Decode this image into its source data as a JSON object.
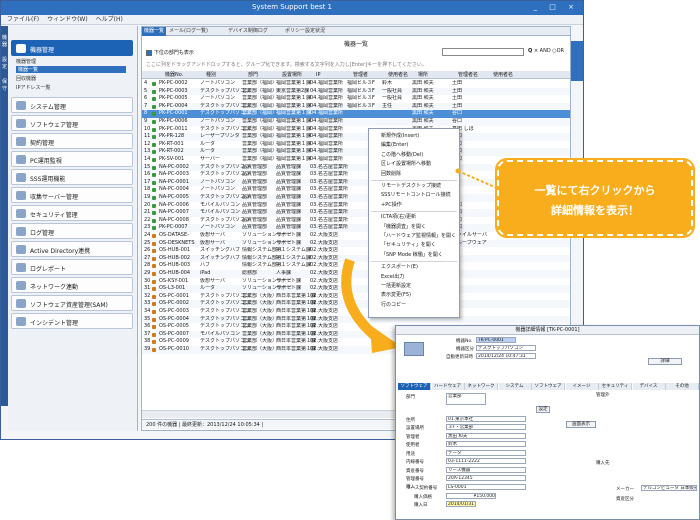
{
  "window": {
    "title": "System Support best 1",
    "controls": "_ □ ×"
  },
  "menu": [
    "ファイル(F)",
    "ウィンドウ(W)",
    "ヘルプ(H)"
  ],
  "left_strip": [
    "機器",
    "設定",
    "保守"
  ],
  "sidebar": {
    "items": [
      {
        "label": "機器管理",
        "selected": true
      },
      {
        "label": "システム管理"
      },
      {
        "label": "ソフトウェア管理"
      },
      {
        "label": "契約管理"
      },
      {
        "label": "PC運用監視"
      },
      {
        "label": "SSS運用機能"
      },
      {
        "label": "収集サーバー管理"
      },
      {
        "label": "セキュリティ管理"
      },
      {
        "label": "ログ管理"
      },
      {
        "label": "Active Directory連携"
      },
      {
        "label": "ログレポート"
      },
      {
        "label": "ネットワーク連動"
      },
      {
        "label": "ソフトウェア資産管理(SAM)"
      },
      {
        "label": "インシデント管理"
      }
    ],
    "sub_head": "機器管理",
    "sub_items": [
      "機器一覧",
      "回収機器",
      "IPアドレス一覧"
    ]
  },
  "main": {
    "tabs": [
      "機器一覧",
      "メール(ログ一覧)",
      "デバイス制御ログ",
      "ポリシー設定状況"
    ],
    "page_title": "機器一覧",
    "filter_check": "下位の部門も表示",
    "search_placeholder": "",
    "search_opts": "AND ○OR",
    "hint": "ここに列をドラッグアンドドロップすると、グループ化できます。検索する文字列を入力し[Enter]キーを押下してください。",
    "columns": [
      "",
      "機器No.",
      "種別",
      "部門",
      "設置場所",
      "IP",
      "管理者",
      "使用者名",
      "場所",
      "管理者名",
      "使用者名"
    ],
    "rows": [
      [
        "4",
        "PK-PC-0002",
        "ノートパソコン",
        "営業部（福岡）",
        "福岡営業第１課",
        "04.福岡営業所",
        "福岡ビル３F",
        "鈴木",
        "黒田 和夫",
        "土田",
        "#3a9a3a"
      ],
      [
        "5",
        "PK-PC-0003",
        "デスクトップパソコン",
        "営業部（福岡）",
        "東京営業第2課",
        "04.福岡営業所",
        "福岡ビル３F",
        "一般社員",
        "黒田 和夫",
        "土田",
        "#3a9a3a"
      ],
      [
        "6",
        "PK-PC-0005",
        "ノートパソコン",
        "営業部（福岡）",
        "福岡営業第１課",
        "04.福岡営業所",
        "福岡ビル３F",
        "一般社員",
        "黒田 和夫",
        "土田",
        "#3a9a3a"
      ],
      [
        "7",
        "PK-PC-0004",
        "デスクトップパソコン",
        "営業部（福岡）",
        "福岡営業第１課",
        "04.福岡営業所",
        "福岡ビル３F",
        "主任",
        "黒田 和夫",
        "土田",
        "#3a9a3a"
      ],
      [
        "8",
        "PK-PC-0001",
        "デスクトップパソコン",
        "営業部（福岡）",
        "福岡営業第１課",
        "04.福岡営業所",
        "",
        "",
        "黒田 和夫",
        "谷口",
        "#3a9a3a"
      ],
      [
        "9",
        "PK-PC-0006",
        "ノートパソコン",
        "営業部（福岡）",
        "福岡営業第１課",
        "04.福岡営業所",
        "",
        "",
        "黒田 和夫",
        "谷口",
        "#3a9a3a"
      ],
      [
        "10",
        "PK-PC-0011",
        "デスクトップパソコン",
        "営業部（福岡）",
        "福岡営業第１課",
        "04.福岡営業所",
        "",
        "",
        "黒田 和夫",
        "真田 しほ",
        "#3a9a3a"
      ],
      [
        "11",
        "PK-PR-128",
        "レーザープリンタ",
        "営業部（福岡）",
        "福岡営業第１課",
        "04.福岡営業所",
        "",
        "",
        "黒田 和夫",
        "谷口",
        "#3a9a3a"
      ],
      [
        "12",
        "PK-RT-001",
        "ルータ",
        "営業部（福岡）",
        "福岡営業第１課",
        "04.福岡営業所",
        "",
        "",
        "黒田 和夫",
        "谷口",
        "#3a9a3a"
      ],
      [
        "13",
        "PK-RT-002",
        "ルータ",
        "営業部（福岡）",
        "福岡営業第１課",
        "04.福岡営業所",
        "",
        "",
        "黒田 和夫",
        "谷口",
        "#3a9a3a"
      ],
      [
        "14",
        "PK-SV-001",
        "サーバー",
        "営業部（福岡）",
        "福岡営業第１課",
        "04.福岡営業所",
        "",
        "",
        "黒田 和夫",
        "谷口",
        "#3a9a3a"
      ],
      [
        "15",
        "NA-PC-0002",
        "デスクトップパソコン",
        "品質管理部",
        "品質管理課",
        "03.名古屋営業所",
        "",
        "",
        "太田 和夫",
        "",
        "#3a9a3a"
      ],
      [
        "16",
        "NA-PC-0003",
        "デスクトップパソコン",
        "品質管理部",
        "品質管理課",
        "03.名古屋営業所",
        "",
        "",
        "太田 和夫",
        "",
        "#3a9a3a"
      ],
      [
        "17",
        "NA-PC-0001",
        "ノートパソコン",
        "品質管理部",
        "品質管理課",
        "03.名古屋営業所",
        "",
        "",
        "太田 和夫",
        "",
        "#3a9a3a"
      ],
      [
        "18",
        "NA-PC-0004",
        "ノートパソコン",
        "品質管理部",
        "品質管理課",
        "03.名古屋営業所",
        "",
        "",
        "太田 和夫",
        "",
        "#3a9a3a"
      ],
      [
        "19",
        "NA-PC-0005",
        "デスクトップパソコン",
        "品質管理部",
        "品質管理課",
        "03.名古屋営業所",
        "",
        "",
        "太田 和夫",
        "",
        "#3a9a3a"
      ],
      [
        "20",
        "NA-PC-0006",
        "モバイルパソコン",
        "品質管理部",
        "品質管理課",
        "03.名古屋営業所",
        "",
        "",
        "太田 和夫",
        "谷口",
        "#3a9a3a"
      ],
      [
        "21",
        "NA-PC-0007",
        "モバイルパソコン",
        "品質管理部",
        "品質管理課",
        "03.名古屋営業所",
        "",
        "",
        "太田 和夫",
        "谷口",
        "#3a9a3a"
      ],
      [
        "22",
        "NA-PC-0008",
        "デスクトップパソコン",
        "品質管理部",
        "品質管理課",
        "03.名古屋営業所",
        "",
        "",
        "太田 和夫",
        "谷口",
        "#3a9a3a"
      ],
      [
        "23",
        "PK-PC-0007",
        "ノートパソコン",
        "品質管理部",
        "品質管理課",
        "03.名古屋営業所",
        "",
        "",
        "太田 和夫",
        "谷口",
        "#3a9a3a"
      ],
      [
        "24",
        "OS-DATASE-",
        "仮想サーバ",
        "ソリューションサービ",
        "サポート課",
        "02.大阪支店",
        "",
        "",
        "木下 紫",
        "ファイルサーバ",
        "#d07a1a"
      ],
      [
        "25",
        "OS-DESKNETS",
        "仮想サーバ",
        "ソリューションサービ",
        "サポート課",
        "02.大阪支店",
        "",
        "",
        "木下 紫",
        "グループウェア",
        "#d07a1a"
      ],
      [
        "26",
        "OS-HUB-001",
        "スイッチングハブ",
        "情報システム部（",
        "第１システム課",
        "02.大阪支店",
        "",
        "",
        "木下 紫",
        "",
        "#d07a1a"
      ],
      [
        "27",
        "OS-HUB-002",
        "スイッチングハブ",
        "情報システム部（",
        "第１システム課",
        "02.大阪支店",
        "",
        "",
        "",
        "",
        "#d07a1a"
      ],
      [
        "28",
        "OS-HUB-003",
        "ハブ",
        "情報システム部（",
        "第１システム課",
        "02.大阪支店",
        "",
        "",
        "",
        "",
        "#d07a1a"
      ],
      [
        "29",
        "OS-HUB-004",
        "iPad",
        "総務部",
        "人事課",
        "02.大阪支店",
        "",
        "",
        "",
        "",
        "#d07a1a"
      ],
      [
        "30",
        "OS-KSY-001",
        "仮想サーバ",
        "ソリューションサービ",
        "サポート課",
        "02.大阪支店",
        "",
        "",
        "",
        "",
        "#d07a1a"
      ],
      [
        "31",
        "OS-L3-001",
        "ルータ",
        "ソリューションサービ",
        "サポート課",
        "02.大阪支店",
        "",
        "",
        "",
        "",
        "#d07a1a"
      ],
      [
        "32",
        "OS-PC-0001",
        "デスクトップパソコン",
        "営業部（大阪）",
        "西日本営業第１課",
        "02.大阪支店",
        "",
        "",
        "",
        "",
        "#d07a1a"
      ],
      [
        "33",
        "OS-PC-0002",
        "デスクトップパソコン",
        "営業部（大阪）",
        "西日本営業第１課",
        "02.大阪支店",
        "",
        "",
        "",
        "",
        "#d07a1a"
      ],
      [
        "34",
        "OS-PC-0003",
        "デスクトップパソコン",
        "営業部（大阪）",
        "西日本営業第１課",
        "02.大阪支店",
        "",
        "",
        "",
        "",
        "#d07a1a"
      ],
      [
        "35",
        "OS-PC-0004",
        "デスクトップパソコン",
        "営業部（大阪）",
        "西日本営業第１課",
        "02.大阪支店",
        "",
        "",
        "",
        "",
        "#d07a1a"
      ],
      [
        "36",
        "OS-PC-0005",
        "デスクトップパソコン",
        "営業部（大阪）",
        "西日本営業第１課",
        "02.大阪支店",
        "",
        "",
        "",
        "",
        "#d07a1a"
      ],
      [
        "37",
        "OS-PC-0007",
        "モバイルパソコン",
        "営業部（大阪）",
        "西日本営業第１課",
        "02.大阪支店",
        "",
        "",
        "",
        "",
        "#d07a1a"
      ],
      [
        "38",
        "OS-PC-0009",
        "デスクトップパソコン",
        "営業部（大阪）",
        "西日本営業第１課",
        "02.大阪支店",
        "",
        "",
        "",
        "",
        "#d07a1a"
      ],
      [
        "39",
        "OS-PC-0010",
        "デスクトップパソコン",
        "営業部（大阪）",
        "西日本営業第１課",
        "02.大阪支店",
        "",
        "",
        "",
        "",
        "#d07a1a"
      ]
    ],
    "selected_row": 4,
    "status": "200 件の機器 | 最終更新：2013/12/24 10:05:34 |"
  },
  "context_menu": [
    "新規作成(Insert)",
    "編集(Enter)",
    "この階へ移動(Del)",
    "区レイ設置場所へ移動",
    "回数削除",
    "リモートデスクトップ接続",
    "SSSリモートコントロール接続",
    "+PC操作",
    "ICTA項(右)更新",
    "「機器調査」を開く",
    "「ハードウェア監視情報」を開く",
    "「セキュリティ」を開く",
    "「SNP Mode 稼働」を開く",
    "エクスポート(E)",
    "Excel出力",
    "一括更新設定",
    "表示変更(F5)",
    "行のコピー"
  ],
  "callout": {
    "line1": "一覧にて右クリックから",
    "line2": "詳細情報を表示！"
  },
  "detail": {
    "title": "機器詳細情報 [TK-PC-0001]",
    "device_no_label": "機器No.",
    "device_no": "TK-PC-0001",
    "type_label": "機器区分",
    "type": "デスクトップパソコン",
    "date_label": "自動更新日時",
    "date": "2014/12/24 10:47:31",
    "tabs": [
      "ソフトウェア",
      "ハードウェア",
      "ネットワーク",
      "システム",
      "ソフトウェア",
      "イメージ",
      "セキュリティ",
      "デバイス",
      "その他"
    ],
    "fields": [
      [
        "部門",
        "営業部"
      ],
      [
        "住所",
        "01.東京本社"
      ],
      [
        "設置場所",
        "３F・営業部"
      ],
      [
        "管理者",
        "黒田 和夫"
      ],
      [
        "使用者",
        "鈴木"
      ],
      [
        "用途",
        "データ"
      ],
      [
        "内線番号",
        "03-1111-2222"
      ],
      [
        "資産番号",
        "リース機器"
      ],
      [
        "管理番号",
        "20A-12345"
      ],
      [
        "リース契約番号",
        "LS-0001"
      ]
    ],
    "purchase_label": "購入",
    "price_label": "購入価格",
    "price": "¥150,000",
    "date2_label": "購入日",
    "date2": "2014/01/31",
    "buttons": {
      "ok": "追加",
      "edit": "編集",
      "setting": "設定",
      "display": "画面表示",
      "manager": "所属",
      "more": "詳細"
    },
    "assets_label": "資産区分",
    "maker_label": "メーカー",
    "maker": "デルコンピュータ 日本販売",
    "no_label": "管理外",
    "dept_label": "購入先"
  }
}
